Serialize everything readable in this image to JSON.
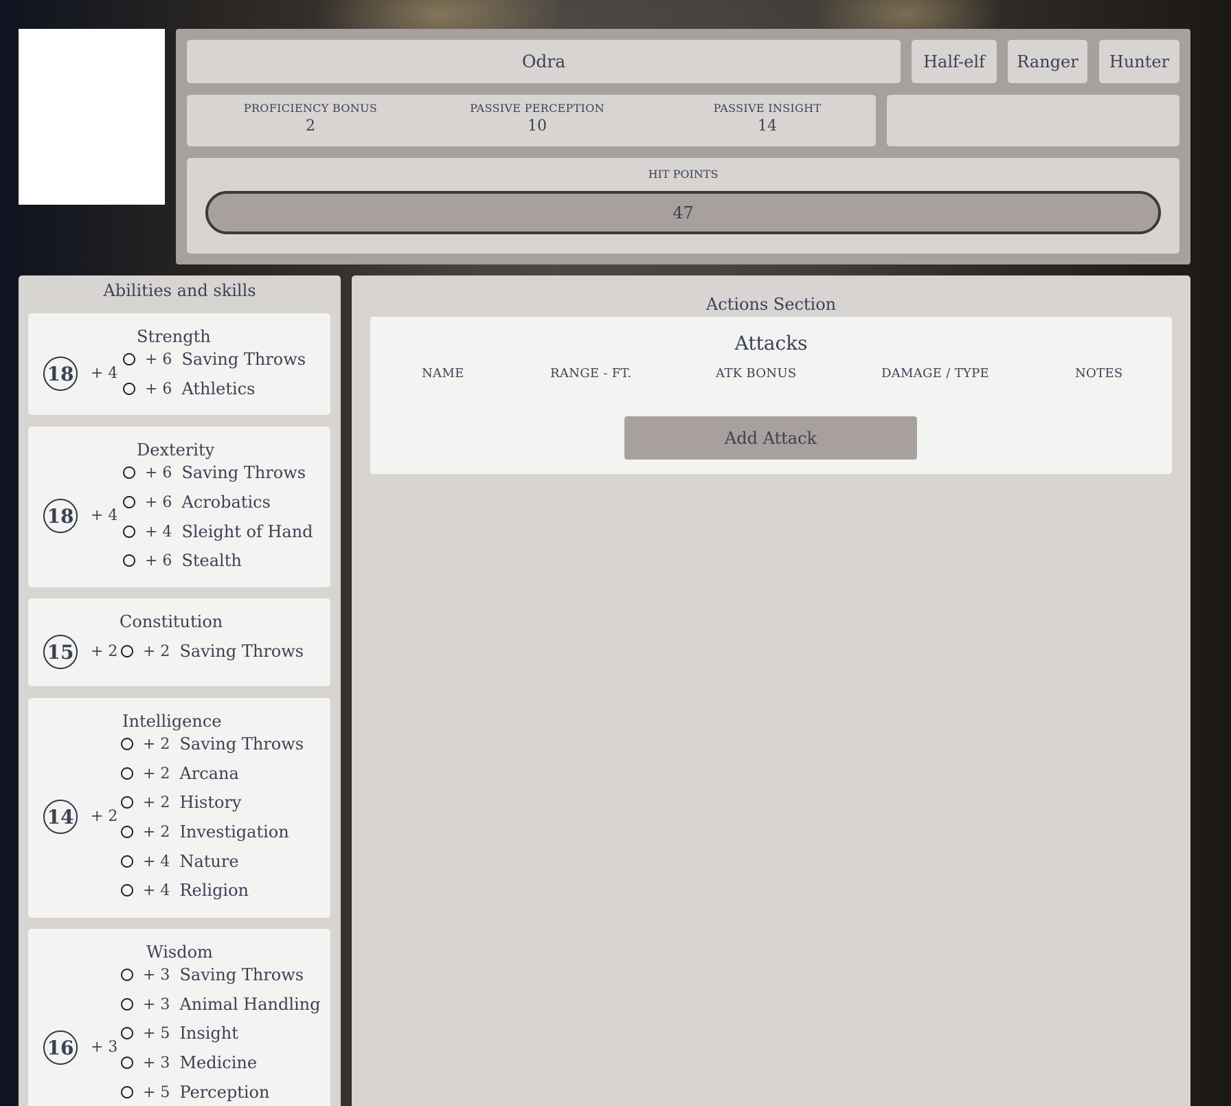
{
  "character": {
    "name": "Odra",
    "race": "Half-elf",
    "class": "Ranger",
    "subclass": "Hunter"
  },
  "stats": {
    "proficiency_bonus_label": "PROFICIENCY BONUS",
    "proficiency_bonus": "2",
    "passive_perception_label": "PASSIVE PERCEPTION",
    "passive_perception": "10",
    "passive_insight_label": "PASSIVE INSIGHT",
    "passive_insight": "14"
  },
  "hp": {
    "label": "HIT POINTS",
    "value": "47"
  },
  "abilities_section": {
    "title": "Abilities and skills",
    "abilities": [
      {
        "name": "Strength",
        "score": "18",
        "mod": "+ 4",
        "skills": [
          {
            "bonus": "+ 6",
            "label": "Saving Throws"
          },
          {
            "bonus": "+ 6",
            "label": "Athletics"
          }
        ]
      },
      {
        "name": "Dexterity",
        "score": "18",
        "mod": "+ 4",
        "skills": [
          {
            "bonus": "+ 6",
            "label": "Saving Throws"
          },
          {
            "bonus": "+ 6",
            "label": "Acrobatics"
          },
          {
            "bonus": "+ 4",
            "label": "Sleight of Hand"
          },
          {
            "bonus": "+ 6",
            "label": "Stealth"
          }
        ]
      },
      {
        "name": "Constitution",
        "score": "15",
        "mod": "+ 2",
        "skills": [
          {
            "bonus": "+ 2",
            "label": "Saving Throws"
          }
        ]
      },
      {
        "name": "Intelligence",
        "score": "14",
        "mod": "+ 2",
        "skills": [
          {
            "bonus": "+ 2",
            "label": "Saving Throws"
          },
          {
            "bonus": "+ 2",
            "label": "Arcana"
          },
          {
            "bonus": "+ 2",
            "label": "History"
          },
          {
            "bonus": "+ 2",
            "label": "Investigation"
          },
          {
            "bonus": "+ 4",
            "label": "Nature"
          },
          {
            "bonus": "+ 4",
            "label": "Religion"
          }
        ]
      },
      {
        "name": "Wisdom",
        "score": "16",
        "mod": "+ 3",
        "skills": [
          {
            "bonus": "+ 3",
            "label": "Saving Throws"
          },
          {
            "bonus": "+ 3",
            "label": "Animal Handling"
          },
          {
            "bonus": "+ 5",
            "label": "Insight"
          },
          {
            "bonus": "+ 3",
            "label": "Medicine"
          },
          {
            "bonus": "+ 5",
            "label": "Perception"
          }
        ]
      }
    ]
  },
  "actions_section": {
    "title": "Actions Section",
    "attacks": {
      "title": "Attacks",
      "columns": [
        "NAME",
        "RANGE - FT.",
        "ATK BONUS",
        "DAMAGE / TYPE",
        "NOTES"
      ],
      "add_label": "Add Attack"
    }
  },
  "colors": {
    "panel": "#d8d4d2",
    "card": "#f3f3f1",
    "header_bg": "#a7a09e",
    "text": "#3b4256"
  }
}
